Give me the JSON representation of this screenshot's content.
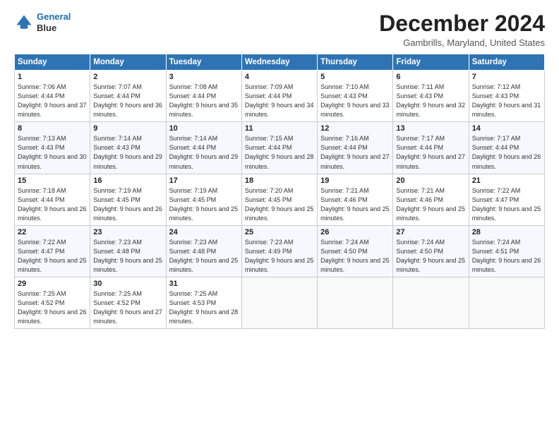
{
  "header": {
    "logo_line1": "General",
    "logo_line2": "Blue",
    "title": "December 2024",
    "subtitle": "Gambrills, Maryland, United States"
  },
  "columns": [
    "Sunday",
    "Monday",
    "Tuesday",
    "Wednesday",
    "Thursday",
    "Friday",
    "Saturday"
  ],
  "weeks": [
    [
      {
        "day": "1",
        "sunrise": "Sunrise: 7:06 AM",
        "sunset": "Sunset: 4:44 PM",
        "daylight": "Daylight: 9 hours and 37 minutes."
      },
      {
        "day": "2",
        "sunrise": "Sunrise: 7:07 AM",
        "sunset": "Sunset: 4:44 PM",
        "daylight": "Daylight: 9 hours and 36 minutes."
      },
      {
        "day": "3",
        "sunrise": "Sunrise: 7:08 AM",
        "sunset": "Sunset: 4:44 PM",
        "daylight": "Daylight: 9 hours and 35 minutes."
      },
      {
        "day": "4",
        "sunrise": "Sunrise: 7:09 AM",
        "sunset": "Sunset: 4:44 PM",
        "daylight": "Daylight: 9 hours and 34 minutes."
      },
      {
        "day": "5",
        "sunrise": "Sunrise: 7:10 AM",
        "sunset": "Sunset: 4:43 PM",
        "daylight": "Daylight: 9 hours and 33 minutes."
      },
      {
        "day": "6",
        "sunrise": "Sunrise: 7:11 AM",
        "sunset": "Sunset: 4:43 PM",
        "daylight": "Daylight: 9 hours and 32 minutes."
      },
      {
        "day": "7",
        "sunrise": "Sunrise: 7:12 AM",
        "sunset": "Sunset: 4:43 PM",
        "daylight": "Daylight: 9 hours and 31 minutes."
      }
    ],
    [
      {
        "day": "8",
        "sunrise": "Sunrise: 7:13 AM",
        "sunset": "Sunset: 4:43 PM",
        "daylight": "Daylight: 9 hours and 30 minutes."
      },
      {
        "day": "9",
        "sunrise": "Sunrise: 7:14 AM",
        "sunset": "Sunset: 4:43 PM",
        "daylight": "Daylight: 9 hours and 29 minutes."
      },
      {
        "day": "10",
        "sunrise": "Sunrise: 7:14 AM",
        "sunset": "Sunset: 4:44 PM",
        "daylight": "Daylight: 9 hours and 29 minutes."
      },
      {
        "day": "11",
        "sunrise": "Sunrise: 7:15 AM",
        "sunset": "Sunset: 4:44 PM",
        "daylight": "Daylight: 9 hours and 28 minutes."
      },
      {
        "day": "12",
        "sunrise": "Sunrise: 7:16 AM",
        "sunset": "Sunset: 4:44 PM",
        "daylight": "Daylight: 9 hours and 27 minutes."
      },
      {
        "day": "13",
        "sunrise": "Sunrise: 7:17 AM",
        "sunset": "Sunset: 4:44 PM",
        "daylight": "Daylight: 9 hours and 27 minutes."
      },
      {
        "day": "14",
        "sunrise": "Sunrise: 7:17 AM",
        "sunset": "Sunset: 4:44 PM",
        "daylight": "Daylight: 9 hours and 26 minutes."
      }
    ],
    [
      {
        "day": "15",
        "sunrise": "Sunrise: 7:18 AM",
        "sunset": "Sunset: 4:44 PM",
        "daylight": "Daylight: 9 hours and 26 minutes."
      },
      {
        "day": "16",
        "sunrise": "Sunrise: 7:19 AM",
        "sunset": "Sunset: 4:45 PM",
        "daylight": "Daylight: 9 hours and 26 minutes."
      },
      {
        "day": "17",
        "sunrise": "Sunrise: 7:19 AM",
        "sunset": "Sunset: 4:45 PM",
        "daylight": "Daylight: 9 hours and 25 minutes."
      },
      {
        "day": "18",
        "sunrise": "Sunrise: 7:20 AM",
        "sunset": "Sunset: 4:45 PM",
        "daylight": "Daylight: 9 hours and 25 minutes."
      },
      {
        "day": "19",
        "sunrise": "Sunrise: 7:21 AM",
        "sunset": "Sunset: 4:46 PM",
        "daylight": "Daylight: 9 hours and 25 minutes."
      },
      {
        "day": "20",
        "sunrise": "Sunrise: 7:21 AM",
        "sunset": "Sunset: 4:46 PM",
        "daylight": "Daylight: 9 hours and 25 minutes."
      },
      {
        "day": "21",
        "sunrise": "Sunrise: 7:22 AM",
        "sunset": "Sunset: 4:47 PM",
        "daylight": "Daylight: 9 hours and 25 minutes."
      }
    ],
    [
      {
        "day": "22",
        "sunrise": "Sunrise: 7:22 AM",
        "sunset": "Sunset: 4:47 PM",
        "daylight": "Daylight: 9 hours and 25 minutes."
      },
      {
        "day": "23",
        "sunrise": "Sunrise: 7:23 AM",
        "sunset": "Sunset: 4:48 PM",
        "daylight": "Daylight: 9 hours and 25 minutes."
      },
      {
        "day": "24",
        "sunrise": "Sunrise: 7:23 AM",
        "sunset": "Sunset: 4:48 PM",
        "daylight": "Daylight: 9 hours and 25 minutes."
      },
      {
        "day": "25",
        "sunrise": "Sunrise: 7:23 AM",
        "sunset": "Sunset: 4:49 PM",
        "daylight": "Daylight: 9 hours and 25 minutes."
      },
      {
        "day": "26",
        "sunrise": "Sunrise: 7:24 AM",
        "sunset": "Sunset: 4:50 PM",
        "daylight": "Daylight: 9 hours and 25 minutes."
      },
      {
        "day": "27",
        "sunrise": "Sunrise: 7:24 AM",
        "sunset": "Sunset: 4:50 PM",
        "daylight": "Daylight: 9 hours and 25 minutes."
      },
      {
        "day": "28",
        "sunrise": "Sunrise: 7:24 AM",
        "sunset": "Sunset: 4:51 PM",
        "daylight": "Daylight: 9 hours and 26 minutes."
      }
    ],
    [
      {
        "day": "29",
        "sunrise": "Sunrise: 7:25 AM",
        "sunset": "Sunset: 4:52 PM",
        "daylight": "Daylight: 9 hours and 26 minutes."
      },
      {
        "day": "30",
        "sunrise": "Sunrise: 7:25 AM",
        "sunset": "Sunset: 4:52 PM",
        "daylight": "Daylight: 9 hours and 27 minutes."
      },
      {
        "day": "31",
        "sunrise": "Sunrise: 7:25 AM",
        "sunset": "Sunset: 4:53 PM",
        "daylight": "Daylight: 9 hours and 28 minutes."
      },
      null,
      null,
      null,
      null
    ]
  ]
}
